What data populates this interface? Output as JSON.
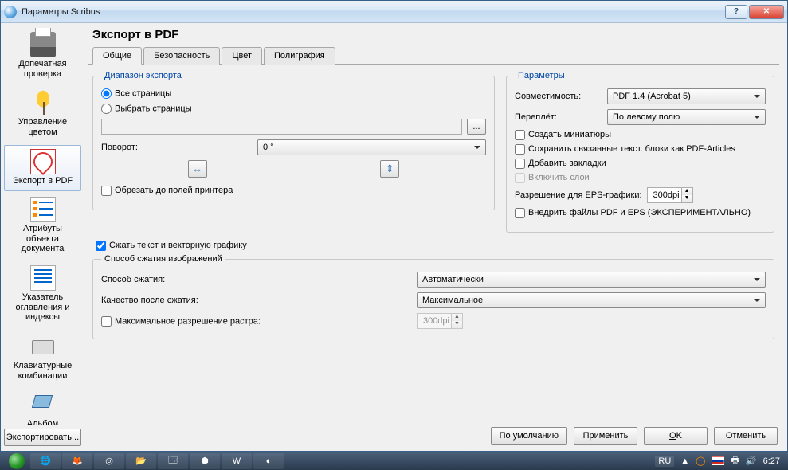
{
  "window": {
    "title": "Параметры Scribus"
  },
  "sidebar": {
    "items": [
      {
        "label": "Допечатная проверка"
      },
      {
        "label": "Управление цветом"
      },
      {
        "label": "Экспорт в PDF"
      },
      {
        "label": "Атрибуты объекта документа"
      },
      {
        "label": "Указатель оглавления и индексы"
      },
      {
        "label": "Клавиатурные комбинации"
      },
      {
        "label": "Альбом"
      }
    ],
    "export_button": "Экспортировать..."
  },
  "main": {
    "heading": "Экспорт в PDF",
    "tabs": [
      "Общие",
      "Безопасность",
      "Цвет",
      "Полиграфия"
    ]
  },
  "range": {
    "legend": "Диапазон экспорта",
    "all_pages": "Все страницы",
    "select_pages": "Выбрать страницы",
    "pages_value": "",
    "browse": "...",
    "rotation_label": "Поворот:",
    "rotation_value": "0 °",
    "clip_to_margins": "Обрезать до полей принтера"
  },
  "params": {
    "legend": "Параметры",
    "compat_label": "Совместимость:",
    "compat_value": "PDF 1.4 (Acrobat 5)",
    "binding_label": "Переплёт:",
    "binding_value": "По левому полю",
    "thumbnails": "Создать миниатюры",
    "articles": "Сохранить связанные текст. блоки как PDF-Articles",
    "bookmarks": "Добавить закладки",
    "layers": "Включить слои",
    "eps_res_label": "Разрешение для EPS-графики:",
    "eps_res_value": "300dpi",
    "embed_pdf": "Внедрить файлы PDF и EPS (ЭКСПЕРИМЕНТАЛЬНО)"
  },
  "compress_text": "Сжать текст и векторную графику",
  "img": {
    "legend": "Способ сжатия изображений",
    "method_label": "Способ сжатия:",
    "method_value": "Автоматически",
    "quality_label": "Качество после сжатия:",
    "quality_value": "Максимальное",
    "max_res_label": "Максимальное разрешение растра:",
    "max_res_value": "300dpi"
  },
  "footer": {
    "defaults": "По умолчанию",
    "apply": "Применить",
    "ok": "OK",
    "cancel": "Отменить"
  },
  "taskbar": {
    "lang": "RU",
    "time": "6:27"
  }
}
